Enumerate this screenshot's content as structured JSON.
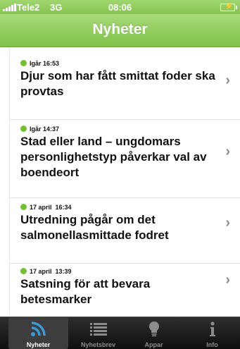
{
  "status_bar": {
    "carrier": "Tele2",
    "network": "3G",
    "time": "08:06"
  },
  "nav": {
    "title": "Nyheter"
  },
  "news": [
    {
      "date": "Igår",
      "time": "16:53",
      "title": "Djur som har fått smittat foder ska provtas"
    },
    {
      "date": "Igår",
      "time": "14:37",
      "title": "Stad eller land – ungdomars personlighetstyp påverkar val av boendeort"
    },
    {
      "date": "17 april",
      "time": "16:34",
      "title": "Utredning pågår om det salmonellasmittade fodret"
    },
    {
      "date": "17 april",
      "time": "13:39",
      "title": "Satsning för att bevara betesmarker"
    }
  ],
  "tabs": [
    {
      "label": "Nyheter",
      "icon": "rss-icon",
      "active": true
    },
    {
      "label": "Nyhetsbrev",
      "icon": "list-icon",
      "active": false
    },
    {
      "label": "Appar",
      "icon": "lightbulb-icon",
      "active": false
    },
    {
      "label": "Info",
      "icon": "info-icon",
      "active": false
    }
  ],
  "colors": {
    "accent_green": "#80c14a",
    "status_dot": "#72c12f",
    "tabbar_bg": "#1a1a1a"
  }
}
